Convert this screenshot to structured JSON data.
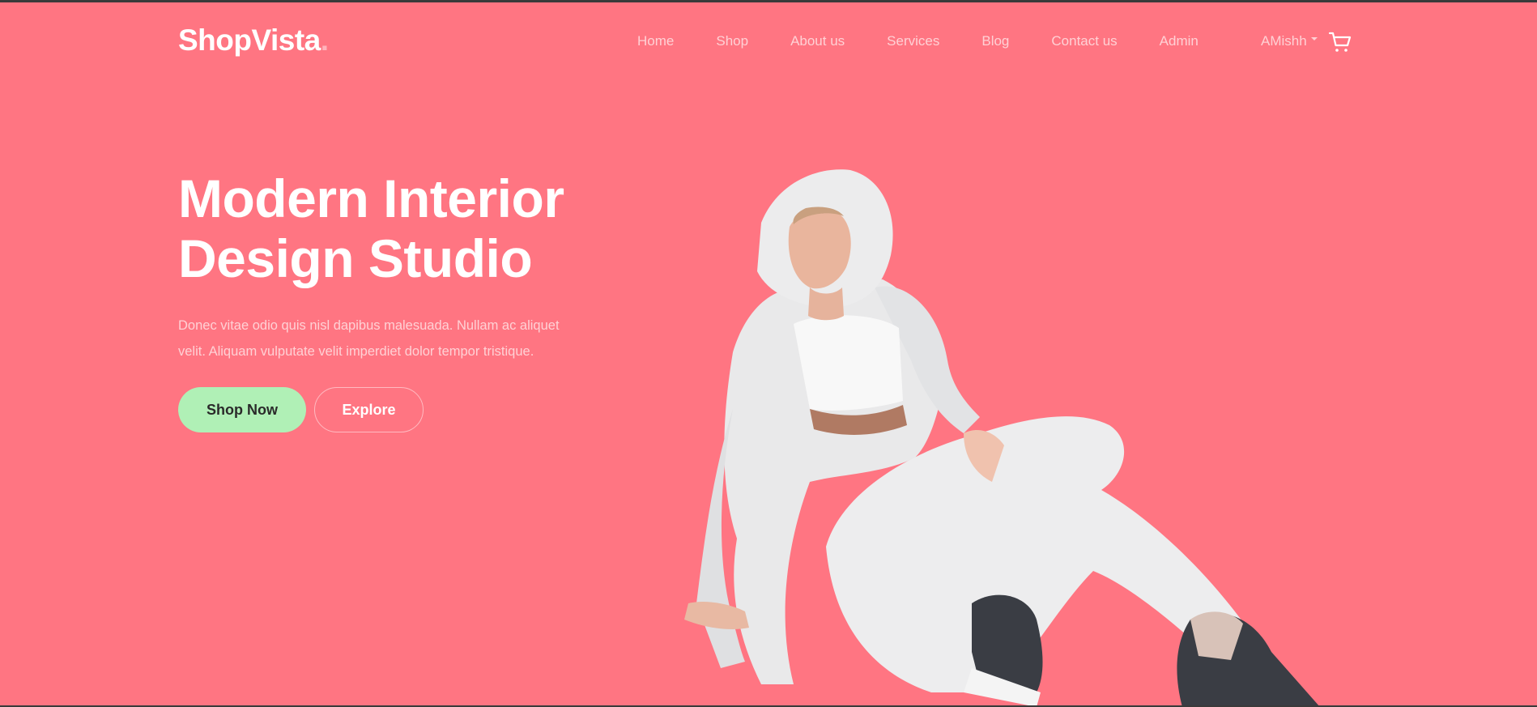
{
  "brand": {
    "name": "ShopVista",
    "dot": "."
  },
  "nav": {
    "links": [
      "Home",
      "Shop",
      "About us",
      "Services",
      "Blog",
      "Contact us",
      "Admin"
    ],
    "user": "AMishh"
  },
  "hero": {
    "title_line1": "Modern Interior",
    "title_line2": "Design Studio",
    "description": "Donec vitae odio quis nisl dapibus malesuada. Nullam ac aliquet velit. Aliquam vulputate velit imperdiet dolor tempor tristique.",
    "primary_button": "Shop Now",
    "secondary_button": "Explore"
  },
  "icons": {
    "cart": "cart-icon",
    "user_menu": "chevron-down-icon"
  },
  "colors": {
    "background": "#ff7582",
    "primary_button": "#b0f0b6",
    "text": "#ffffff",
    "muted_text": "#ffd1d5"
  }
}
